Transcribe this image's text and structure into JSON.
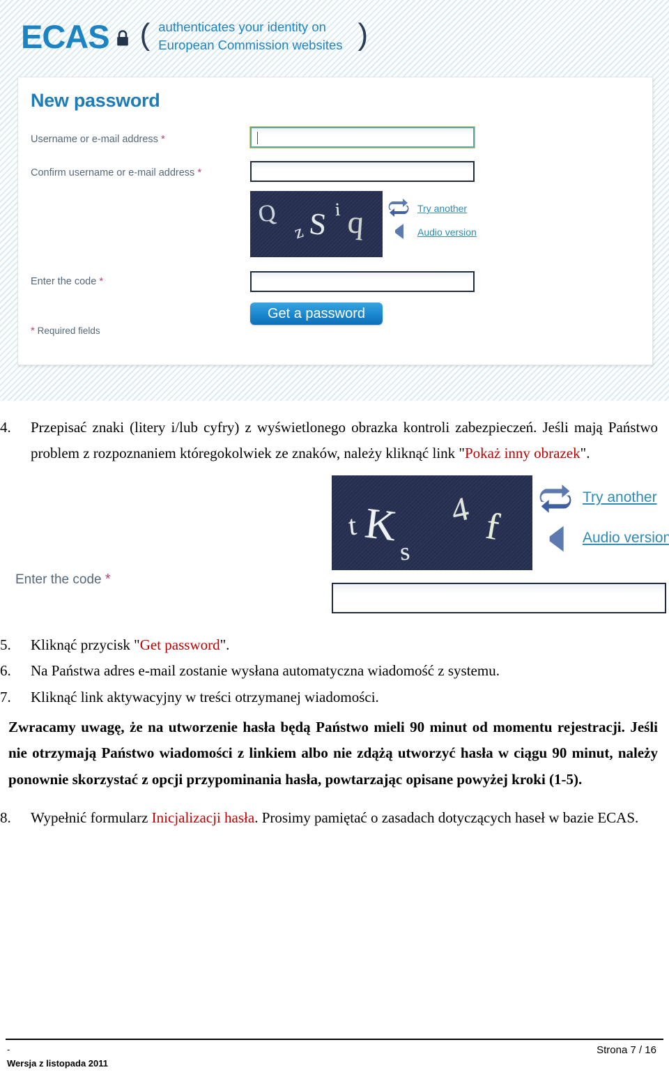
{
  "ecas": {
    "wordmark": "ECAS",
    "paren_open": "(",
    "paren_close": ")",
    "tagline_line1": "authenticates your identity on",
    "tagline_line2": "European Commission websites",
    "brand_color": "#1d84c3",
    "card": {
      "title": "New password",
      "labels": {
        "username": "Username or e-mail address",
        "confirm": "Confirm username or e-mail address",
        "enter_code": "Enter the code"
      },
      "required_marker": "*",
      "required_note_marker": "*",
      "required_note": "Required fields",
      "inputs": {
        "username_value": "",
        "confirm_value": "",
        "code_value": ""
      },
      "captcha_text": "Q zSi q",
      "captcha_chars": [
        "Q",
        "z",
        "S",
        "i",
        "q"
      ],
      "links": {
        "try_another": "Try another",
        "audio_version": "Audio version",
        "link_color": "#2d8bb5"
      },
      "submit_label": "Get a password",
      "submit_color": "#1a86ce"
    }
  },
  "figure2": {
    "label_enter_code": "Enter the code",
    "required_marker": "*",
    "captcha_text": "tKs 4 f",
    "captcha_chars": [
      "t",
      "K",
      "s",
      "4",
      "f"
    ],
    "links": {
      "try_another": "Try another",
      "audio_version": "Audio version"
    },
    "code_value": ""
  },
  "doc": {
    "items": [
      {
        "num": "4.",
        "parts": [
          {
            "text": "Przepisać znaki (litery i/lub cyfry) z wyświetlonego obrazka kontroli zabezpieczeń. Jeśli mają Państwo problem z rozpoznaniem któregokolwiek ze znaków, należy kliknąć link \"",
            "style": "plain"
          },
          {
            "text": "Pokaż inny obrazek",
            "style": "red"
          },
          {
            "text": "\".",
            "style": "plain"
          }
        ]
      },
      {
        "num": "5.",
        "parts": [
          {
            "text": "Kliknąć przycisk \"",
            "style": "plain"
          },
          {
            "text": "Get password",
            "style": "red"
          },
          {
            "text": "\".",
            "style": "plain"
          }
        ]
      },
      {
        "num": "6.",
        "parts": [
          {
            "text": "Na Państwa adres e-mail zostanie wysłana automatyczna wiadomość z systemu.",
            "style": "plain"
          }
        ]
      },
      {
        "num": "7.",
        "parts": [
          {
            "text": "Kliknąć link aktywacyjny w treści otrzymanej wiadomości.",
            "style": "plain"
          }
        ]
      }
    ],
    "note_paragraph": "Zwracamy uwagę, że na utworzenie hasła będą Państwo mieli 90 minut od momentu rejestracji. Jeśli nie otrzymają Państwo wiadomości z linkiem albo nie zdążą utworzyć hasła w ciągu 90 minut, należy ponownie skorzystać z opcji przypominania hasła, powtarzając opisane powyżej kroki (1-5).",
    "item8": {
      "num": "8.",
      "parts": [
        {
          "text": "Wypełnić formularz ",
          "style": "plain"
        },
        {
          "text": "Inicjalizacji hasła",
          "style": "red"
        },
        {
          "text": ". Prosimy pamiętać o zasadach dotyczących haseł w bazie ECAS.",
          "style": "plain"
        }
      ]
    }
  },
  "footer": {
    "dash": "-",
    "version": "Wersja z listopada 2011",
    "page": "Strona 7 / 16"
  }
}
